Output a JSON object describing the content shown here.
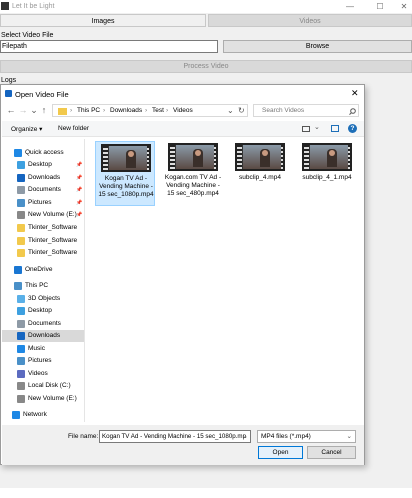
{
  "app": {
    "title": "Let It be Light",
    "window_controls": {
      "minimize": "—",
      "maximize": "☐",
      "close": "✕"
    },
    "tabs": [
      "Images",
      "Videos"
    ],
    "select_label": "Select Video File",
    "filepath_value": "Filepath",
    "browse_label": "Browse",
    "process_label": "Process Video",
    "logs_label": "Logs"
  },
  "dialog": {
    "title": "Open Video File",
    "close": "✕",
    "nav": {
      "back": "←",
      "forward": "→",
      "dropdown": "⌄",
      "up": "↑",
      "refresh": "↻"
    },
    "breadcrumb": [
      "This PC",
      "Downloads",
      "Test",
      "Videos"
    ],
    "search_placeholder": "Search Videos",
    "toolbar": {
      "organize": "Organize ▾",
      "new_folder": "New folder"
    },
    "nav_items": [
      {
        "label": "Quick access",
        "icon": "star-icon",
        "color": "#1e88e5",
        "pinned": false
      },
      {
        "label": "Desktop",
        "icon": "desktop-icon",
        "color": "#3da0e0",
        "pinned": true
      },
      {
        "label": "Downloads",
        "icon": "download-icon",
        "color": "#1565c0",
        "pinned": true
      },
      {
        "label": "Documents",
        "icon": "document-icon",
        "color": "#8e9aa6",
        "pinned": true
      },
      {
        "label": "Pictures",
        "icon": "pictures-icon",
        "color": "#4a90c8",
        "pinned": true
      },
      {
        "label": "New Volume (E:)",
        "icon": "drive-icon",
        "color": "#888888",
        "pinned": true
      },
      {
        "label": "Tkinter_Software",
        "icon": "folder-icon",
        "color": "#f2c94c",
        "pinned": false
      },
      {
        "label": "Tkinter_Software",
        "icon": "folder-icon",
        "color": "#f2c94c",
        "pinned": false
      },
      {
        "label": "Tkinter_Software",
        "icon": "folder-icon",
        "color": "#f2c94c",
        "pinned": false
      },
      {
        "label": "OneDrive",
        "icon": "cloud-icon",
        "color": "#1976d2",
        "pinned": false
      },
      {
        "label": "This PC",
        "icon": "computer-icon",
        "color": "#4a90c8",
        "pinned": false
      },
      {
        "label": "3D Objects",
        "icon": "cube-icon",
        "color": "#5ab0e8",
        "pinned": false
      },
      {
        "label": "Desktop",
        "icon": "desktop-icon",
        "color": "#3da0e0",
        "pinned": false
      },
      {
        "label": "Documents",
        "icon": "document-icon",
        "color": "#8e9aa6",
        "pinned": false
      },
      {
        "label": "Downloads",
        "icon": "download-icon",
        "color": "#1565c0",
        "pinned": false,
        "selected": true
      },
      {
        "label": "Music",
        "icon": "music-icon",
        "color": "#1e88e5",
        "pinned": false
      },
      {
        "label": "Pictures",
        "icon": "pictures-icon",
        "color": "#4a90c8",
        "pinned": false
      },
      {
        "label": "Videos",
        "icon": "video-icon",
        "color": "#5c6bc0",
        "pinned": false
      },
      {
        "label": "Local Disk (C:)",
        "icon": "drive-icon",
        "color": "#888888",
        "pinned": false
      },
      {
        "label": "New Volume (E:)",
        "icon": "drive-icon",
        "color": "#888888",
        "pinned": false
      },
      {
        "label": "Network",
        "icon": "network-icon",
        "color": "#1e88e5",
        "pinned": false
      }
    ],
    "files": [
      {
        "name": "Kogan TV Ad - Vending Machine - 15 sec_1080p.mp4",
        "selected": true
      },
      {
        "name": "Kogan.com TV Ad - Vending Machine - 15 sec_480p.mp4",
        "selected": false
      },
      {
        "name": "subclip_4.mp4",
        "selected": false
      },
      {
        "name": "subclip_4_1.mp4",
        "selected": false
      }
    ],
    "file_name_label": "File name:",
    "file_name_value": "Kogan TV Ad - Vending Machine - 15 sec_1080p.mp",
    "file_type": "MP4 files (*.mp4)",
    "open_label": "Open",
    "cancel_label": "Cancel"
  }
}
